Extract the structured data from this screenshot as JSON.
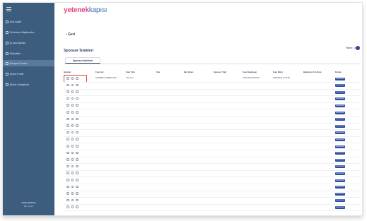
{
  "sidebar": {
    "items": [
      {
        "label": "Ana sayfa",
        "active": false
      },
      {
        "label": "Ürünlerim Bağlantıları",
        "active": false
      },
      {
        "label": "İş İlanı İlanları",
        "active": false
      },
      {
        "label": "Etkinlikler",
        "active": false
      },
      {
        "label": "Kariyer Fuarları",
        "active": true
      },
      {
        "label": "Şirket Profili",
        "active": false
      },
      {
        "label": "Şirket Çalışanları",
        "active": false
      }
    ],
    "footer_line1": "Yardım Merkezi",
    "footer_line2": "Ver. 1.1.27"
  },
  "logo": {
    "part1": "yetenek",
    "part2": "kapısı"
  },
  "back_label": "Geri",
  "page_title": "Sponsor İstekleri",
  "filter_label": "Filtrele",
  "tab_label": "Sponsor İstekleri",
  "table": {
    "headers": [
      "İşlemler",
      "Fuar Adı",
      "Fuar Türü",
      "Sıra",
      "İlan Çıkarı",
      "Sponsor Türü",
      "Fuar Başlangıç",
      "Fuar Bitişi",
      "Beklenen Fon Notu",
      "Durum"
    ],
    "first_row": [
      "SUMMER CAREER FAIR",
      "Yüz yüze",
      "",
      "",
      "",
      "15/01/2024 09:00:00",
      "02/02/2024 17:00:00",
      ""
    ],
    "status_label": "BEKLEMEDE",
    "row_count": 20
  },
  "colors": {
    "sidebar": "#3d5d7f",
    "active_item": "#5a7a9c",
    "status": "#2d4f9b",
    "highlight": "#e53935",
    "logo_pink": "#e0477d",
    "logo_blue": "#3c6fb0"
  }
}
